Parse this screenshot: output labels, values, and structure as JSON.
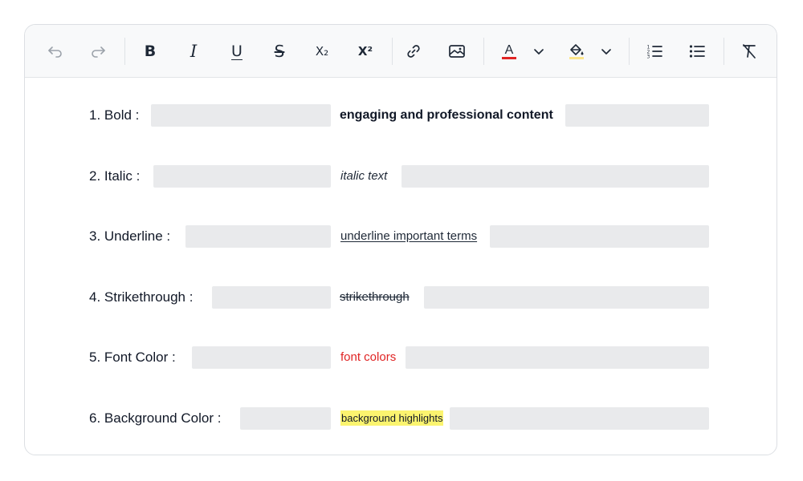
{
  "toolbar": {
    "buttons": [
      {
        "name": "undo",
        "icon": "undo-icon",
        "disabled": true
      },
      {
        "name": "redo",
        "icon": "redo-icon",
        "disabled": true
      },
      {
        "name": "bold",
        "icon": "bold-icon",
        "glyph": "B"
      },
      {
        "name": "italic",
        "icon": "italic-icon",
        "glyph": "I"
      },
      {
        "name": "underline",
        "icon": "underline-icon",
        "glyph": "U"
      },
      {
        "name": "strikethrough",
        "icon": "strikethrough-icon",
        "glyph": "S"
      },
      {
        "name": "subscript",
        "icon": "subscript-icon",
        "glyph": "X₂"
      },
      {
        "name": "superscript",
        "icon": "superscript-icon",
        "glyph": "X²"
      },
      {
        "name": "link",
        "icon": "link-icon"
      },
      {
        "name": "image",
        "icon": "image-icon"
      },
      {
        "name": "font-color",
        "icon": "font-color-icon",
        "glyph": "A",
        "swatch": "#e02424"
      },
      {
        "name": "font-color-dropdown",
        "icon": "chevron-down-icon"
      },
      {
        "name": "background-color",
        "icon": "paint-bucket-icon",
        "swatch": "#fde68a"
      },
      {
        "name": "background-color-dropdown",
        "icon": "chevron-down-icon"
      },
      {
        "name": "ordered-list",
        "icon": "ordered-list-icon"
      },
      {
        "name": "bullet-list",
        "icon": "bullet-list-icon"
      },
      {
        "name": "clear-formatting",
        "icon": "clear-format-icon"
      }
    ]
  },
  "rows": [
    {
      "label": "1. Bold :",
      "sample": "engaging and professional content",
      "style": "bold"
    },
    {
      "label": "2. Italic :",
      "sample": "italic text",
      "style": "italic"
    },
    {
      "label": "3. Underline :",
      "sample": "underline important terms",
      "style": "underline"
    },
    {
      "label": "4. Strikethrough :",
      "sample": "strikethrough",
      "style": "strikethrough"
    },
    {
      "label": "5. Font Color :",
      "sample": "font colors",
      "style": "font-color",
      "color": "#e02424"
    },
    {
      "label": "6. Background Color :",
      "sample": "background highlights",
      "style": "background-color",
      "highlight": "#fbf46f"
    }
  ],
  "colors": {
    "placeholder": "#e9eaec",
    "toolbar_bg": "#f8f9fa",
    "border": "#dcdfe3"
  }
}
